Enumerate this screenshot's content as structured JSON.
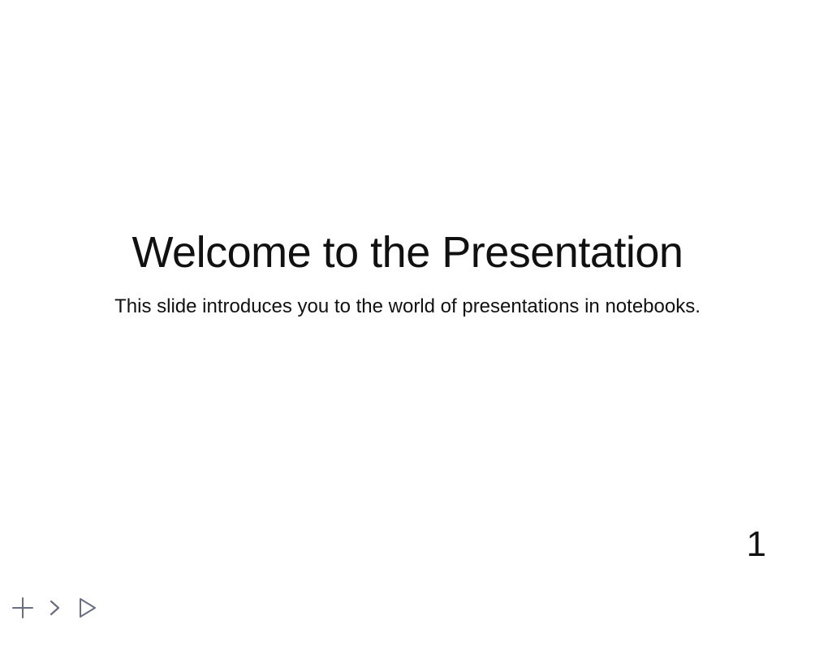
{
  "slide": {
    "title": "Welcome to the Presentation",
    "subtitle": "This slide introduces you to the world of presentations in notebooks.",
    "number": "1"
  },
  "controls": {
    "icons": [
      "plus-icon",
      "chevron-right-icon",
      "play-icon"
    ],
    "icon_color": "#6b6e80"
  }
}
